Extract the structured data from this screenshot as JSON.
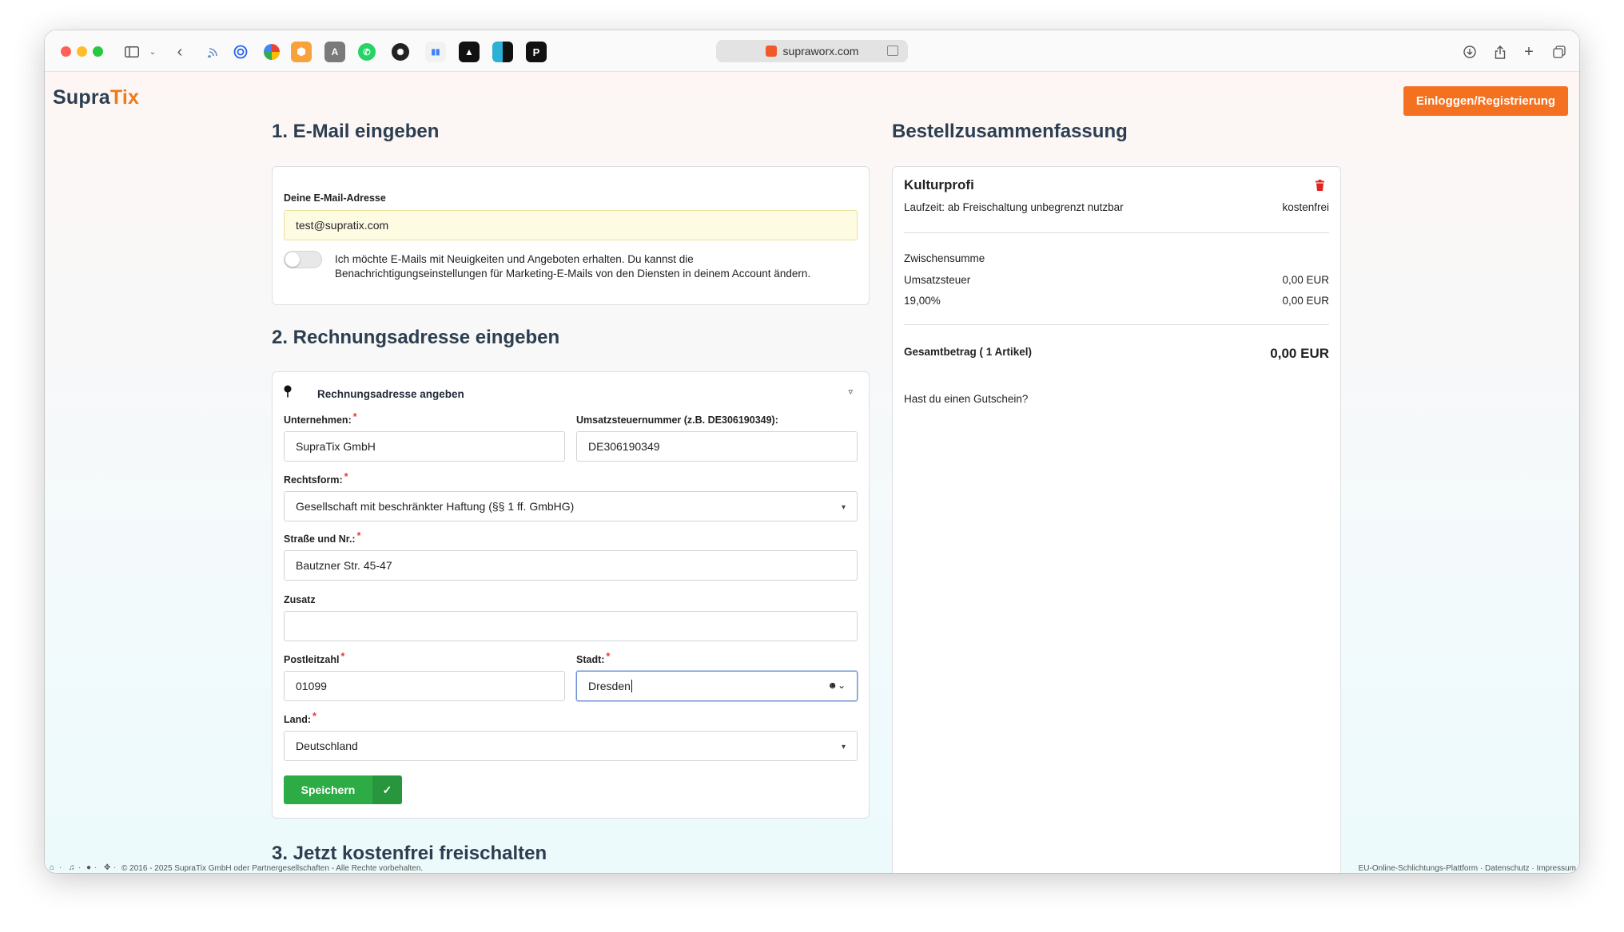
{
  "browser": {
    "url": "supraworx.com"
  },
  "header": {
    "logo_part1": "Supra",
    "logo_part2": "Tix",
    "login_label": "Einloggen/Registrierung"
  },
  "step1": {
    "title": "1. E-Mail eingeben",
    "email_label": "Deine E-Mail-Adresse",
    "email_value": "test@supratix.com",
    "newsletter_text_line1": "Ich möchte E-Mails mit Neuigkeiten und Angeboten erhalten. Du kannst die",
    "newsletter_text_line2": "Benachrichtigungseinstellungen für Marketing-E-Mails von den Diensten in deinem Account ändern."
  },
  "step2": {
    "title": "2. Rechnungsadresse eingeben",
    "section_label": "Rechnungsadresse angeben",
    "company_label": "Unternehmen:",
    "company_value": "SupraTix GmbH",
    "vat_label": "Umsatzsteuernummer (z.B. DE306190349):",
    "vat_value": "DE306190349",
    "legal_form_label": "Rechtsform:",
    "legal_form_value": "Gesellschaft mit beschränkter Haftung (§§ 1 ff. GmbHG)",
    "street_label": "Straße und Nr.:",
    "street_value": "Bautzner Str. 45-47",
    "addition_label": "Zusatz",
    "addition_value": "",
    "zip_label": "Postleitzahl",
    "zip_value": "01099",
    "city_label": "Stadt:",
    "city_value": "Dresden",
    "country_label": "Land:",
    "country_value": "Deutschland",
    "save_label": "Speichern"
  },
  "step3": {
    "title": "3. Jetzt kostenfrei freischalten"
  },
  "summary": {
    "title": "Bestellzusammenfassung",
    "product_name": "Kulturprofi",
    "runtime": "Laufzeit: ab Freischaltung unbegrenzt nutzbar",
    "runtime_price": "kostenfrei",
    "subtotal_label": "Zwischensumme",
    "tax_label": "Umsatzsteuer",
    "tax_value": "0,00 EUR",
    "tax_rate_label": "19,00%",
    "tax_rate_value": "0,00 EUR",
    "total_label": "Gesamtbetrag ( 1 Artikel)",
    "total_value": "0,00 EUR",
    "voucher_label": "Hast du einen Gutschein?"
  },
  "footer": {
    "copyright": "© 2016 - 2025 SupraTix GmbH oder Partnergesellschaften - Alle Rechte vorbehalten.",
    "link_odr": "EU-Online-Schlichtungs-Plattform",
    "link_privacy": "Datenschutz",
    "link_imprint": "Impressum",
    "separator": "·"
  },
  "colors": {
    "accent_orange": "#f47120",
    "save_green": "#2dac45",
    "heading": "#2c3e50",
    "required_red": "#e53935"
  }
}
